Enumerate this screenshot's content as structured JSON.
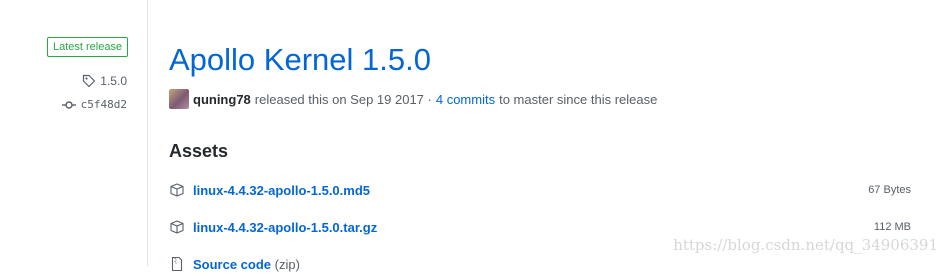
{
  "sidebar": {
    "badge_label": "Latest release",
    "tag_label": "1.5.0",
    "commit_label": "c5f48d2",
    "icons": [
      "tag-icon",
      "git-commit-icon"
    ]
  },
  "release": {
    "title": "Apollo Kernel 1.5.0",
    "author": "quning78",
    "released_text": "released this on Sep 19 2017 ·",
    "commits_link": "4 commits",
    "after_commits_text": "to master since this release"
  },
  "assets": {
    "heading": "Assets",
    "items": [
      {
        "name": "linux-4.4.32-apollo-1.5.0.md5",
        "size": "67 Bytes",
        "icon": "package-icon"
      },
      {
        "name": "linux-4.4.32-apollo-1.5.0.tar.gz",
        "size": "112 MB",
        "icon": "package-icon"
      },
      {
        "name": "Source code",
        "suffix": "(zip)",
        "icon": "file-zip-icon"
      }
    ]
  },
  "watermark": "https://blog.csdn.net/qq_34906391",
  "colors": {
    "link": "#0366d6",
    "badge_green": "#28a745",
    "muted": "#586069",
    "text": "#24292e",
    "divider": "#e1e4e8"
  }
}
